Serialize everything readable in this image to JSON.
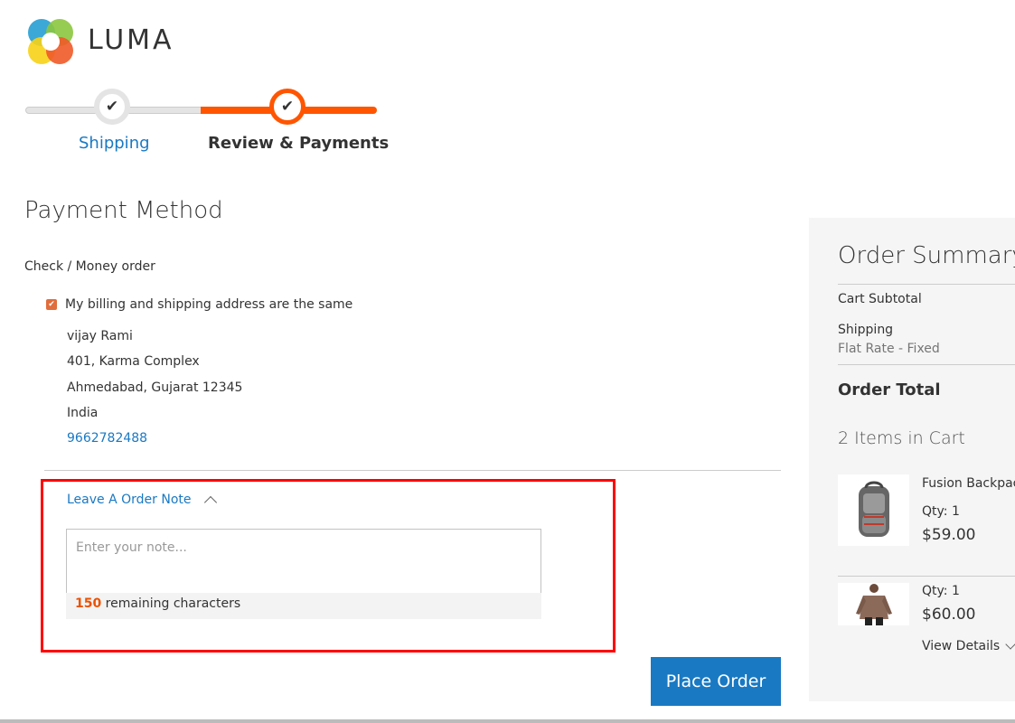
{
  "brand": {
    "name": "LUMA"
  },
  "progress": {
    "steps": [
      {
        "label": "Shipping",
        "state": "complete"
      },
      {
        "label": "Review & Payments",
        "state": "active"
      }
    ]
  },
  "payment": {
    "title": "Payment Method",
    "method": "Check / Money order",
    "same_address_label": "My billing and shipping address are the same",
    "same_address_checked": true,
    "address": {
      "name": "vijay Rami",
      "street": "401, Karma Complex",
      "city_line": "Ahmedabad, Gujarat 12345",
      "country": "India",
      "phone": "9662782488"
    }
  },
  "order_note": {
    "toggle_label": "Leave A Order Note",
    "placeholder": "Enter your note...",
    "value": "",
    "remaining_count": "150",
    "remaining_text": " remaining characters"
  },
  "actions": {
    "place_order": "Place Order"
  },
  "summary": {
    "title": "Order Summary",
    "cart_subtotal_label": "Cart Subtotal",
    "shipping_label": "Shipping",
    "shipping_method": "Flat Rate - Fixed",
    "order_total_label": "Order Total",
    "items_in_cart": "2 Items in Cart",
    "items": [
      {
        "name": "Fusion Backpack",
        "qty": "Qty: 1",
        "price": "$59.00"
      },
      {
        "name": "",
        "qty": "Qty: 1",
        "price": "$60.00",
        "view_details": "View Details"
      }
    ]
  },
  "colors": {
    "accent": "#ff5501",
    "link": "#1979c3",
    "button": "#1979c3",
    "highlight": "#ff0000"
  }
}
